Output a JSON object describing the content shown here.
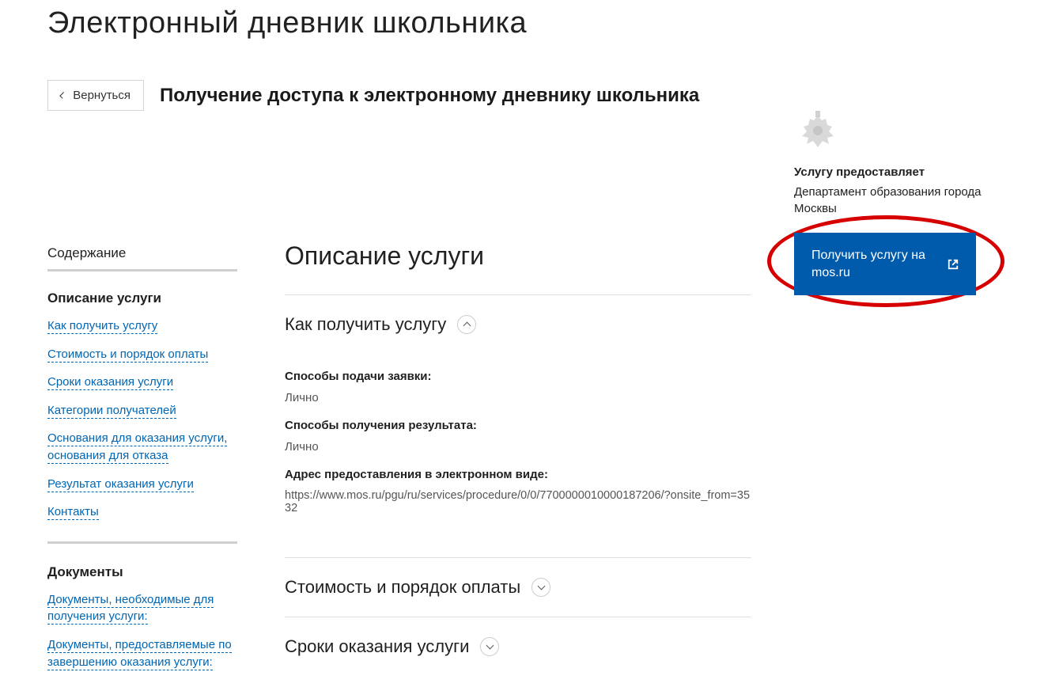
{
  "page_title": "Электронный дневник школьника",
  "back_label": "Вернуться",
  "subtitle": "Получение доступа к электронному дневнику школьника",
  "sidebar": {
    "heading": "Содержание",
    "group1_title": "Описание услуги",
    "links1": [
      "Как получить услугу",
      "Стоимость и порядок оплаты",
      "Сроки оказания услуги",
      "Категории получателей",
      "Основания для оказания услуги, основания для отказа",
      "Результат оказания услуги",
      "Контакты"
    ],
    "group2_title": "Документы",
    "links2": [
      "Документы, необходимые для получения услуги:",
      "Документы, предоставляемые по завершению оказания услуги:"
    ]
  },
  "main": {
    "desc_heading": "Описание услуги",
    "s1": {
      "title": "Как получить услугу",
      "label1": "Способы подачи заявки:",
      "val1": "Лично",
      "label2": "Способы получения результата:",
      "val2": "Лично",
      "label3": "Адрес предоставления в электронном виде:",
      "url": "https://www.mos.ru/pgu/ru/services/procedure/0/0/7700000010000187206/?onsite_from=3532"
    },
    "s2_title": "Стоимость и порядок оплаты",
    "s3_title": "Сроки оказания услуги"
  },
  "provider": {
    "label": "Услугу предоставляет",
    "name": "Департамент образования города Москвы",
    "cta": "Получить услугу на mos.ru"
  }
}
